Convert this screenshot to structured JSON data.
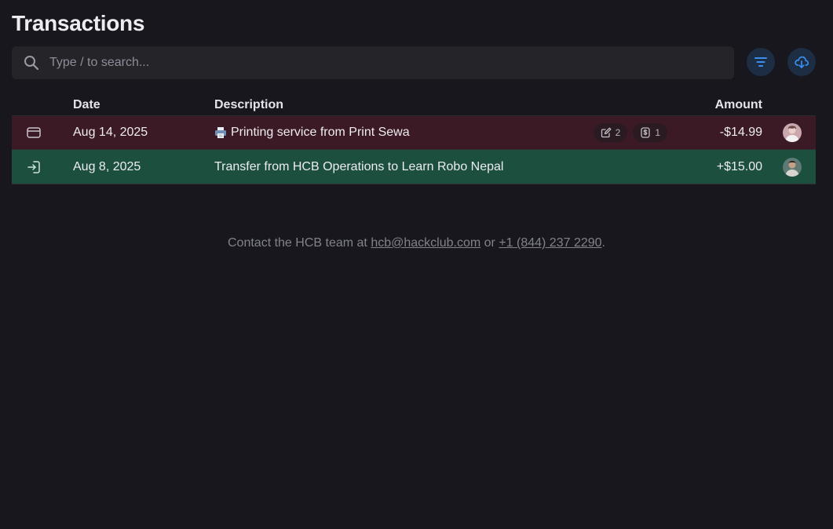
{
  "page": {
    "title": "Transactions"
  },
  "search": {
    "placeholder": "Type / to search..."
  },
  "table": {
    "headers": {
      "date": "Date",
      "description": "Description",
      "amount": "Amount"
    },
    "rows": [
      {
        "type_icon": "card-icon",
        "date": "Aug 14, 2025",
        "emoji": "printer-icon",
        "description": "Printing service from Print Sewa",
        "comments_count": "2",
        "receipts_count": "1",
        "amount": "-$14.99",
        "row_color": "#3c1a25"
      },
      {
        "type_icon": "transfer-in-icon",
        "date": "Aug 8, 2025",
        "description": "Transfer from HCB Operations to Learn Robo Nepal",
        "amount": "+$15.00",
        "row_color": "#1d4f3f"
      }
    ]
  },
  "footer": {
    "prefix": "Contact the HCB team at",
    "email": "hcb@hackclub.com",
    "or": "or",
    "phone": "+1 (844) 237 2290",
    "suffix": "."
  },
  "colors": {
    "background": "#17171d",
    "accent": "#3b8eea"
  }
}
